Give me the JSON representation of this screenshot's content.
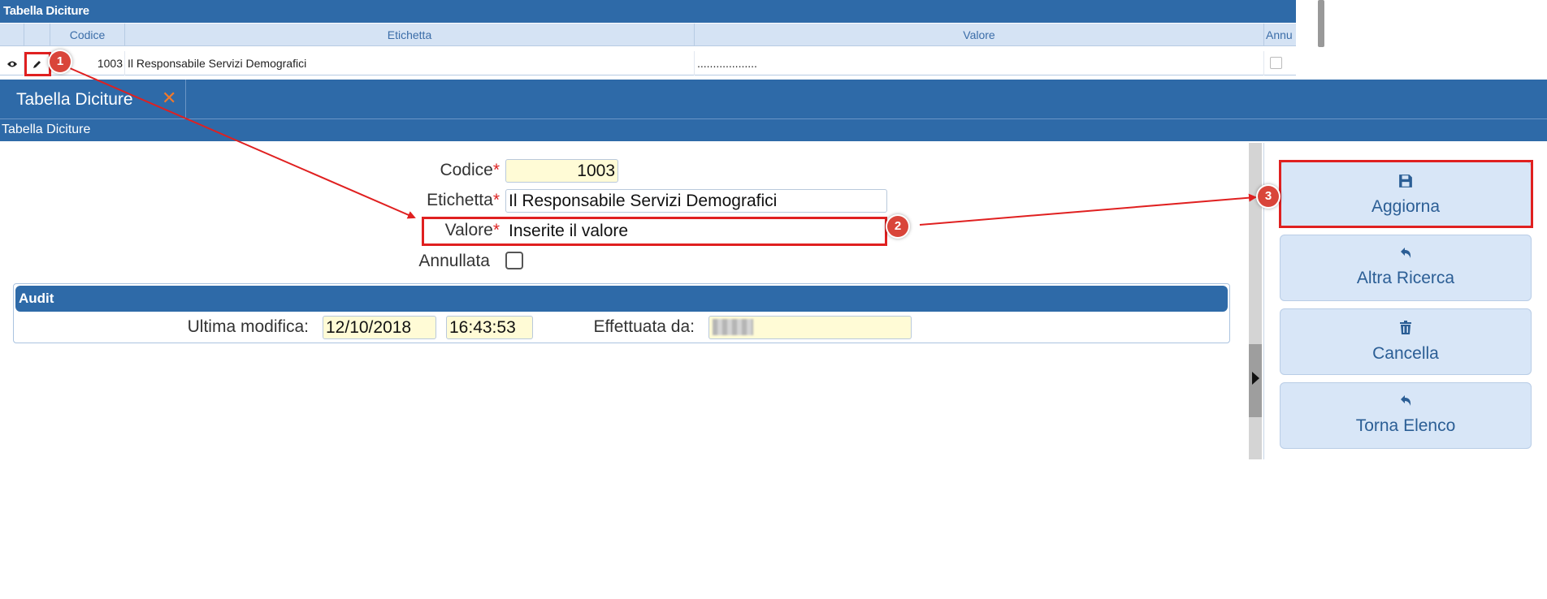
{
  "grid": {
    "title": "Tabella Diciture",
    "columns": {
      "codice": "Codice",
      "etichetta": "Etichetta",
      "valore": "Valore",
      "annullata": "Annu"
    },
    "rows": [
      {
        "codice": "1003",
        "etichetta": "Il Responsabile Servizi Demografici",
        "valore": "...................",
        "annullata": false
      }
    ]
  },
  "tab": {
    "label": "Tabella Diciture",
    "close": "✕"
  },
  "subheader": "Tabella Diciture",
  "form": {
    "codice_label": "Codice",
    "codice_value": "1003",
    "etichetta_label": "Etichetta",
    "etichetta_value": "Il Responsabile Servizi Demografici",
    "valore_label": "Valore",
    "valore_value": "Inserite il valore",
    "annullata_label": "Annullata",
    "required_mark": "*"
  },
  "audit": {
    "title": "Audit",
    "ultima_modifica_label": "Ultima modifica:",
    "date": "12/10/2018",
    "time": "16:43:53",
    "effettuata_da_label": "Effettuata da:"
  },
  "buttons": {
    "aggiorna": "Aggiorna",
    "altra_ricerca": "Altra Ricerca",
    "cancella": "Cancella",
    "torna_elenco": "Torna Elenco"
  },
  "annotations": {
    "one": "1",
    "two": "2",
    "three": "3"
  },
  "colors": {
    "header_blue": "#2e6aa8",
    "button_bg": "#d8e6f7",
    "annotation_red": "#e02020",
    "required_red": "#d22",
    "yellow_field": "#fffbd6"
  },
  "icons": {
    "view": "eye-icon",
    "edit": "pencil-icon",
    "save": "floppy-icon",
    "back": "undo-arrow-icon",
    "delete": "trash-icon",
    "close": "close-icon",
    "collapse": "caret-right-icon"
  }
}
